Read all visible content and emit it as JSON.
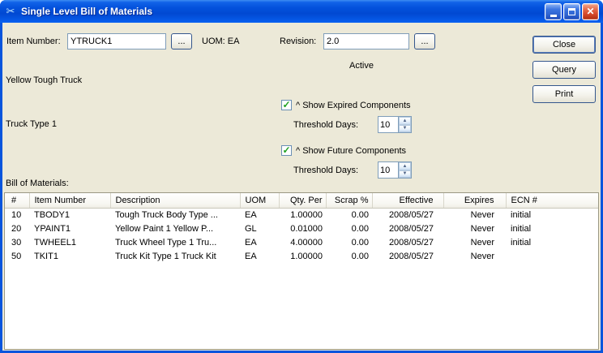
{
  "window": {
    "title": "Single Level Bill of Materials"
  },
  "form": {
    "item_number_label": "Item Number:",
    "item_number_value": "YTRUCK1",
    "item_browse_label": "...",
    "uom_label": "UOM: EA",
    "revision_label": "Revision:",
    "revision_value": "2.0",
    "revision_browse_label": "...",
    "status_text": "Active",
    "item_description": "Yellow Tough Truck",
    "item_note": "Truck Type 1"
  },
  "actions": {
    "close_label": "Close",
    "query_label": "Query",
    "print_label": "Print"
  },
  "options": {
    "expired_label": "^ Show Expired Components",
    "expired_threshold_label": "Threshold Days:",
    "expired_threshold_value": "10",
    "expired_checked": true,
    "future_label": "^ Show Future Components",
    "future_threshold_label": "Threshold Days:",
    "future_threshold_value": "10",
    "future_checked": true
  },
  "bom": {
    "section_label": "Bill of Materials:",
    "columns": [
      "#",
      "Item Number",
      "Description",
      "UOM",
      "Qty. Per",
      "Scrap %",
      "Effective",
      "Expires",
      "ECN #"
    ],
    "rows": [
      [
        "10",
        "TBODY1",
        "Tough Truck Body Type ...",
        "EA",
        "1.00000",
        "0.00",
        "2008/05/27",
        "Never",
        "initial"
      ],
      [
        "20",
        "YPAINT1",
        "Yellow Paint 1  Yellow P...",
        "GL",
        "0.01000",
        "0.00",
        "2008/05/27",
        "Never",
        "initial"
      ],
      [
        "30",
        "TWHEEL1",
        "Truck Wheel Type 1 Tru...",
        "EA",
        "4.00000",
        "0.00",
        "2008/05/27",
        "Never",
        "initial"
      ],
      [
        "50",
        "TKIT1",
        "Truck Kit Type 1 Truck Kit",
        "EA",
        "1.00000",
        "0.00",
        "2008/05/27",
        "Never",
        ""
      ]
    ]
  }
}
